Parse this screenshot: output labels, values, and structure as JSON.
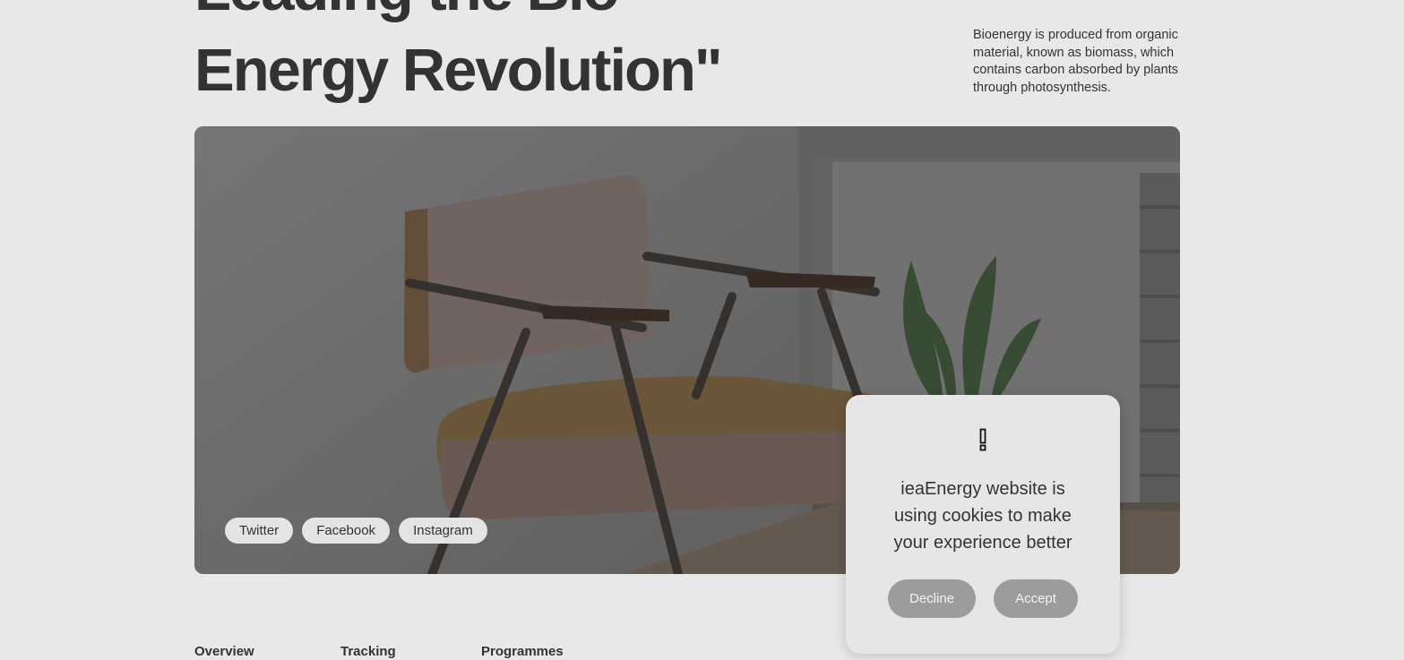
{
  "hero": {
    "headline_line1": "Leading the Bio",
    "headline_line2": "Energy Revolution\"",
    "intro": "Bioenergy is produced from organic material, known as biomass, which contains carbon absorbed by plants through photosynthesis."
  },
  "social": {
    "items": [
      {
        "label": "Twitter",
        "icon": "twitter-link"
      },
      {
        "label": "Facebook",
        "icon": "facebook-link"
      },
      {
        "label": "Instagram",
        "icon": "instagram-link"
      }
    ]
  },
  "tabs": [
    {
      "label": "Overview"
    },
    {
      "label": "Tracking"
    },
    {
      "label": "Programmes"
    }
  ],
  "cookie": {
    "icon": "exclamation-icon",
    "message": "ieaEnergy website is using cookies to make your experience better",
    "decline_label": "Decline",
    "accept_label": "Accept"
  },
  "colors": {
    "background": "#e8e8e8",
    "text": "#333333",
    "button": "#9c9c9c",
    "pill": "#e4e4e4"
  }
}
